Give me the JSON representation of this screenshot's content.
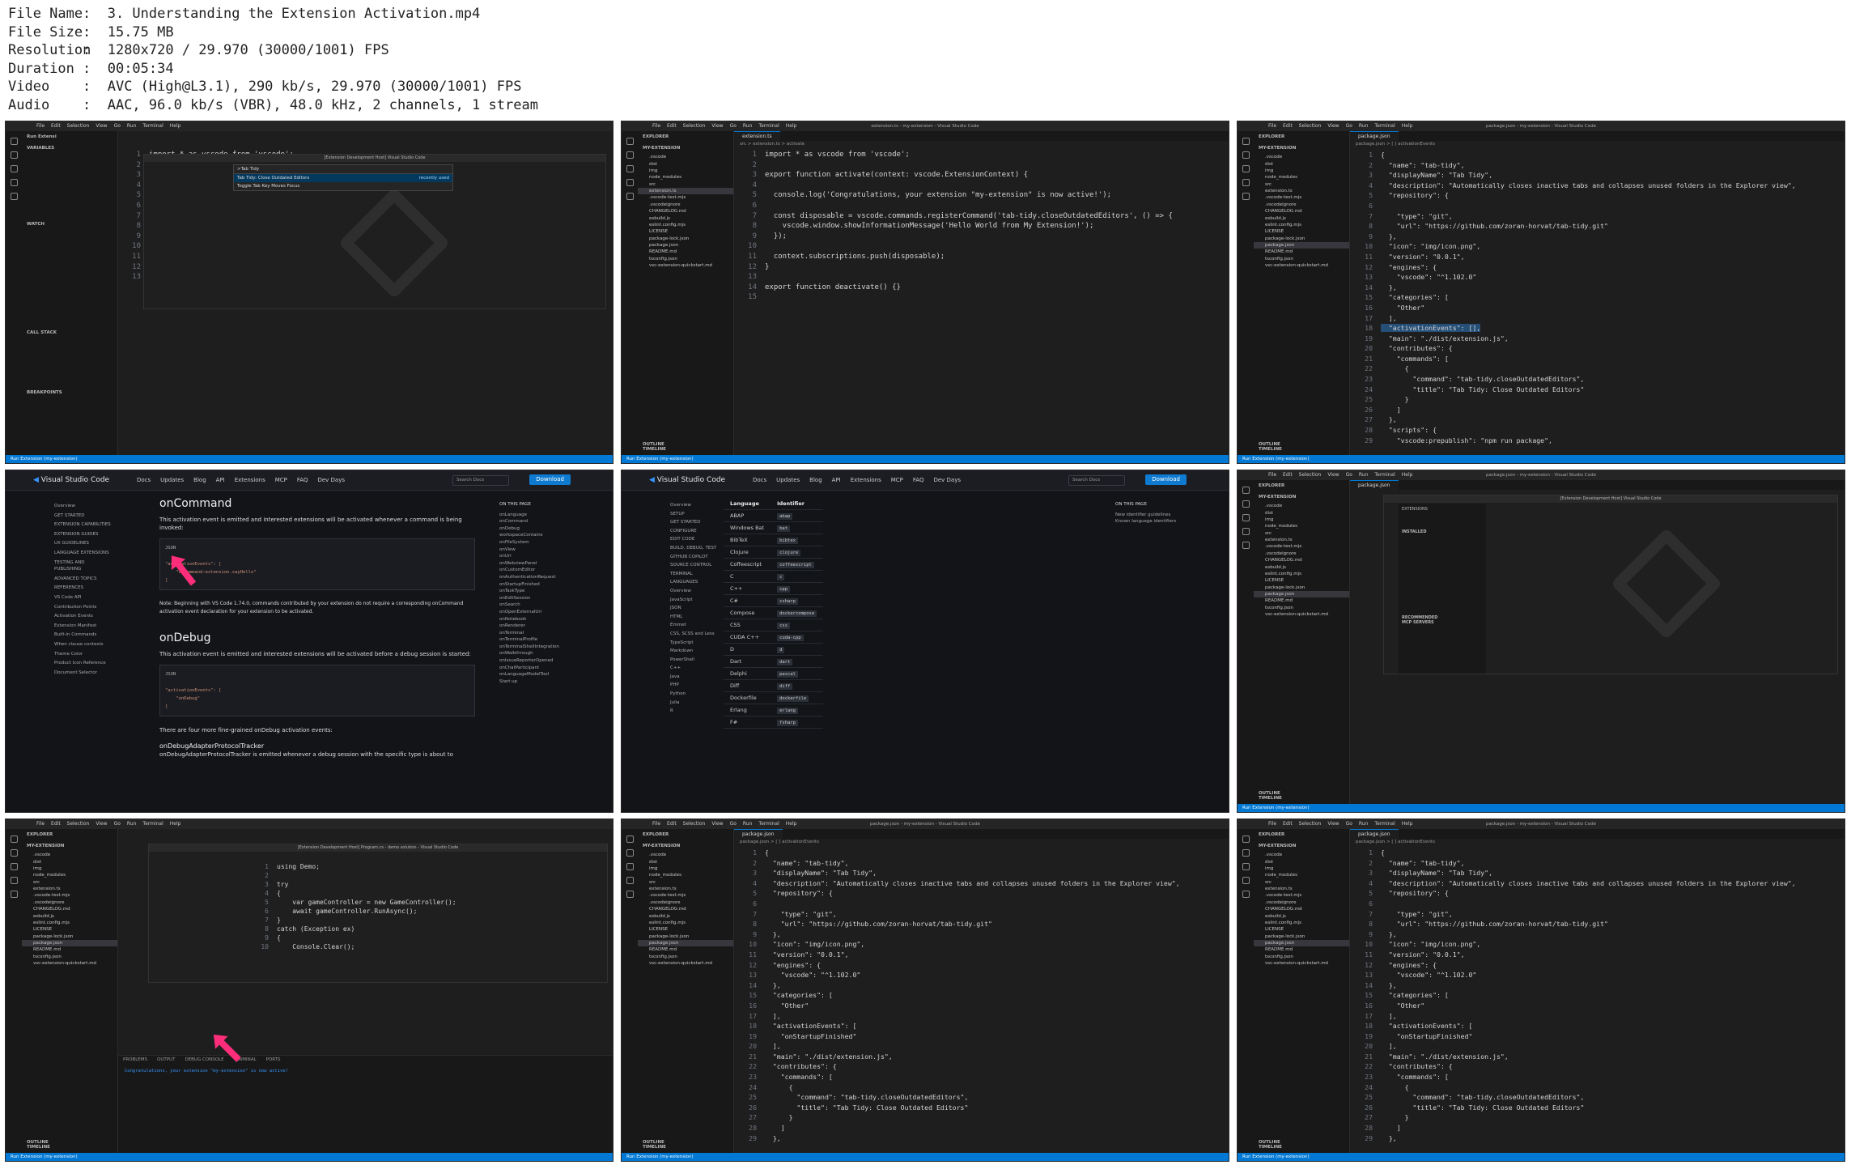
{
  "file_info": [
    {
      "label": "File Name",
      "value": "3. Understanding the Extension Activation.mp4"
    },
    {
      "label": "File Size",
      "value": "15.75 MB"
    },
    {
      "label": "Resolution",
      "value": "1280x720 / 29.970 (30000/1001) FPS"
    },
    {
      "label": "Duration",
      "value": "00:05:34"
    },
    {
      "label": "Video",
      "value": "AVC (High@L3.1), 290 kb/s, 29.970 (30000/1001) FPS"
    },
    {
      "label": "Audio",
      "value": "AAC, 96.0 kb/s (VBR), 48.0 kHz, 2 channels, 1 stream"
    }
  ],
  "vscode": {
    "menu": [
      "File",
      "Edit",
      "Selection",
      "View",
      "Go",
      "Run",
      "Terminal",
      "Help"
    ],
    "title_ext": "extension.ts - my-extension - Visual Studio Code",
    "title_pkg": "package.json - my-extension - Visual Studio Code",
    "explorer_label": "EXPLORER",
    "project": "MY-EXTENSION",
    "files": [
      ".vscode",
      "dist",
      "img",
      "node_modules",
      "src",
      "extension.ts",
      ".vscode-test.mjs",
      ".vscodeignore",
      "CHANGELOG.md",
      "esbuild.js",
      "eslint.config.mjs",
      "LICENSE",
      "package-lock.json",
      "package.json",
      "README.md",
      "tsconfig.json",
      "vsc-extension-quickstart.md"
    ],
    "outline": "OUTLINE",
    "timeline": "TIMELINE",
    "status_run": "Run Extension (my-extension)",
    "tab_ext": "extension.ts",
    "tab_pkg": "package.json",
    "crumb_ext": "src > extension.ts > activate",
    "crumb_pkg": "package.json > [ ] activationEvents",
    "debug_panel": {
      "variables": "VARIABLES",
      "watch": "WATCH",
      "call_stack": "CALL STACK",
      "breakpoints": "BREAKPOINTS",
      "run_label": "Run Extensi"
    },
    "command_palette": {
      "input": ">Tab Tidy",
      "item1": "Tab Tidy: Close Outdated Editors",
      "item1_tag": "recently used",
      "item2": "Toggle Tab Key Moves Focus"
    },
    "panel_tabs": [
      "PROBLEMS",
      "OUTPUT",
      "DEBUG CONSOLE",
      "TERMINAL",
      "PORTS"
    ],
    "debug_console_msg": "Congratulations, your extension \"my-extension\" is now active!",
    "extensions_view": {
      "title": "EXTENSIONS",
      "installed": "INSTALLED",
      "recommended": "RECOMMENDED",
      "mcp": "MCP SERVERS"
    }
  },
  "code_ext": [
    "import * as vscode from 'vscode';",
    "",
    "export function activate(context: vscode.ExtensionContext) {",
    "",
    "  console.log('Congratulations, your extension \"my-extension\" is now active!');",
    "",
    "  const disposable = vscode.commands.registerCommand('tab-tidy.closeOutdatedEditors', () => {",
    "    vscode.window.showInformationMessage('Hello World from My Extension!');",
    "  });",
    "",
    "  context.subscriptions.push(disposable);",
    "}",
    "",
    "export function deactivate() {}",
    ""
  ],
  "code_pkg_empty": [
    "{",
    "  \"name\": \"tab-tidy\",",
    "  \"displayName\": \"Tab Tidy\",",
    "  \"description\": \"Automatically closes inactive tabs and collapses unused folders in the Explorer view\",",
    "  \"repository\": {",
    "",
    "    \"type\": \"git\",",
    "    \"url\": \"https://github.com/zoran-horvat/tab-tidy.git\"",
    "  },",
    "  \"icon\": \"img/icon.png\",",
    "  \"version\": \"0.0.1\",",
    "  \"engines\": {",
    "    \"vscode\": \"^1.102.0\"",
    "  },",
    "  \"categories\": [",
    "    \"Other\"",
    "  ],",
    "  \"activationEvents\": [],",
    "  \"main\": \"./dist/extension.js\",",
    "  \"contributes\": {",
    "    \"commands\": [",
    "      {",
    "        \"command\": \"tab-tidy.closeOutdatedEditors\",",
    "        \"title\": \"Tab Tidy: Close Outdated Editors\"",
    "      }",
    "    ]",
    "  },",
    "  \"scripts\": {",
    "    \"vscode:prepublish\": \"npm run package\","
  ],
  "code_pkg_startup": [
    "{",
    "  \"name\": \"tab-tidy\",",
    "  \"displayName\": \"Tab Tidy\",",
    "  \"description\": \"Automatically closes inactive tabs and collapses unused folders in the Explorer view\",",
    "  \"repository\": {",
    "",
    "    \"type\": \"git\",",
    "    \"url\": \"https://github.com/zoran-horvat/tab-tidy.git\"",
    "  },",
    "  \"icon\": \"img/icon.png\",",
    "  \"version\": \"0.0.1\",",
    "  \"engines\": {",
    "    \"vscode\": \"^1.102.0\"",
    "  },",
    "  \"categories\": [",
    "    \"Other\"",
    "  ],",
    "  \"activationEvents\": [",
    "    \"onStartupFinished\"",
    "  ],",
    "  \"main\": \"./dist/extension.js\",",
    "  \"contributes\": {",
    "    \"commands\": [",
    "      {",
    "        \"command\": \"tab-tidy.closeOutdatedEditors\",",
    "        \"title\": \"Tab Tidy: Close Outdated Editors\"",
    "      }",
    "    ]",
    "  },"
  ],
  "code_csharp": [
    "using Demo;",
    "",
    "try",
    "{",
    "    var gameController = new GameController();",
    "    await gameController.RunAsync();",
    "}",
    "catch (Exception ex)",
    "{",
    "    Console.Clear();"
  ],
  "docs": {
    "brand": "Visual Studio Code",
    "nav": [
      "Docs",
      "Updates",
      "Blog",
      "API",
      "Extensions",
      "MCP",
      "FAQ",
      "Dev Days"
    ],
    "search": "Search Docs",
    "download": "Download",
    "left_nav": [
      "Overview",
      "GET STARTED",
      "EXTENSION CAPABILITIES",
      "EXTENSION GUIDES",
      "UX GUIDELINES",
      "LANGUAGE EXTENSIONS",
      "TESTING AND PUBLISHING",
      "ADVANCED TOPICS",
      "REFERENCES",
      "VS Code API",
      "Contribution Points",
      "Activation Events",
      "Extension Manifest",
      "Built-in Commands",
      "When clause contexts",
      "Theme Color",
      "Product Icon Reference",
      "Document Selector"
    ],
    "on_page": "ON THIS PAGE",
    "on_page_items": [
      "onLanguage",
      "onCommand",
      "onDebug",
      "workspaceContains",
      "onFileSystem",
      "onView",
      "onUri",
      "onWebviewPanel",
      "onCustomEditor",
      "onAuthenticationRequest",
      "onStartupFinished",
      "onTaskType",
      "onEditSession",
      "onSearch",
      "onOpenExternalUri",
      "onNotebook",
      "onRenderer",
      "onTerminal",
      "onTerminalProfile",
      "onTerminalShellIntegration",
      "onWalkthrough",
      "onIssueReporterOpened",
      "onChatParticipant",
      "onLanguageModelTool",
      "Start up"
    ],
    "s1_title": "onCommand",
    "s1_text": "This activation event is emitted and interested extensions will be activated whenever a command is being invoked:",
    "code_label": "JSON",
    "s1_code": "\"activationEvents\": [\n    \"onCommand:extension.sayHello\"\n]",
    "s1_note": "Note: Beginning with VS Code 1.74.0, commands contributed by your extension do not require a corresponding onCommand activation event declaration for your extension to be activated.",
    "s2_title": "onDebug",
    "s2_text": "This activation event is emitted and interested extensions will be activated before a debug session is started:",
    "s2_code": "\"activationEvents\": [\n    \"onDebug\"\n]",
    "s2_more": "There are four more fine-grained onDebug activation events:",
    "s3_title": "onDebugAdapterProtocolTracker",
    "s3_text": "onDebugAdapterProtocolTracker is emitted whenever a debug session with the specific type is about to"
  },
  "lang_docs": {
    "left_nav": [
      "Overview",
      "SETUP",
      "GET STARTED",
      "CONFIGURE",
      "EDIT CODE",
      "BUILD, DEBUG, TEST",
      "GITHUB COPILOT",
      "SOURCE CONTROL",
      "TERMINAL",
      "LANGUAGES",
      "Overview",
      "JavaScript",
      "JSON",
      "HTML",
      "Emmet",
      "CSS, SCSS and Less",
      "TypeScript",
      "Markdown",
      "PowerShell",
      "C++",
      "Java",
      "PHP",
      "Python",
      "Julia",
      "R"
    ],
    "col_lang": "Language",
    "col_id": "Identifier",
    "rows": [
      [
        "ABAP",
        "abap"
      ],
      [
        "Windows Bat",
        "bat"
      ],
      [
        "BibTeX",
        "bibtex"
      ],
      [
        "Clojure",
        "clojure"
      ],
      [
        "Coffeescript",
        "coffeescript"
      ],
      [
        "C",
        "c"
      ],
      [
        "C++",
        "cpp"
      ],
      [
        "C#",
        "csharp"
      ],
      [
        "Compose",
        "dockercompose"
      ],
      [
        "CSS",
        "css"
      ],
      [
        "CUDA C++",
        "cuda-cpp"
      ],
      [
        "D",
        "d"
      ],
      [
        "Dart",
        "dart"
      ],
      [
        "Delphi",
        "pascal"
      ],
      [
        "Diff",
        "diff"
      ],
      [
        "Dockerfile",
        "dockerfile"
      ],
      [
        "Erlang",
        "erlang"
      ],
      [
        "F#",
        "fsharp"
      ]
    ],
    "on_page": "ON THIS PAGE",
    "on_page_items": [
      "New identifier guidelines",
      "Known language identifiers"
    ]
  }
}
